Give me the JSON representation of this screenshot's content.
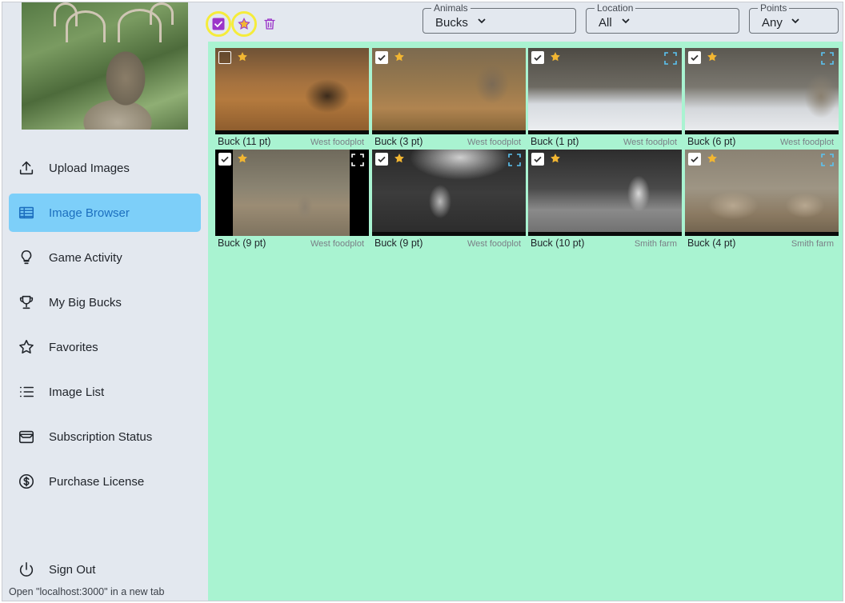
{
  "sidebar": {
    "items": [
      {
        "label": "Upload Images",
        "icon": "upload-icon"
      },
      {
        "label": "Image Browser",
        "icon": "table-icon",
        "active": true
      },
      {
        "label": "Game Activity",
        "icon": "lightbulb-icon"
      },
      {
        "label": "My Big Bucks",
        "icon": "trophy-icon"
      },
      {
        "label": "Favorites",
        "icon": "star-icon"
      },
      {
        "label": "Image List",
        "icon": "list-icon"
      },
      {
        "label": "Subscription Status",
        "icon": "wallet-icon"
      },
      {
        "label": "Purchase License",
        "icon": "dollar-circle-icon"
      }
    ],
    "sign_out": {
      "label": "Sign Out",
      "icon": "power-icon"
    }
  },
  "status_hint": "Open \"localhost:3000\" in a new tab",
  "toolbar": {
    "select_icon": "checkbox-icon",
    "favorite_icon": "star-icon",
    "delete_icon": "trash-icon",
    "filters": {
      "animals": {
        "label": "Animals",
        "value": "Bucks"
      },
      "location": {
        "label": "Location",
        "value": "All"
      },
      "points": {
        "label": "Points",
        "value": "Any"
      }
    }
  },
  "images": [
    {
      "caption": "Buck (11 pt)",
      "location": "West foodplot",
      "checked": false,
      "favorite": true
    },
    {
      "caption": "Buck (3 pt)",
      "location": "West foodplot",
      "checked": true,
      "favorite": true
    },
    {
      "caption": "Buck (1 pt)",
      "location": "West foodplot",
      "checked": true,
      "favorite": true
    },
    {
      "caption": "Buck (6 pt)",
      "location": "West foodplot",
      "checked": true,
      "favorite": true
    },
    {
      "caption": "Buck (9 pt)",
      "location": "West foodplot",
      "checked": true,
      "favorite": true
    },
    {
      "caption": "Buck (9 pt)",
      "location": "West foodplot",
      "checked": true,
      "favorite": true
    },
    {
      "caption": "Buck (10 pt)",
      "location": "Smith farm",
      "checked": true,
      "favorite": true
    },
    {
      "caption": "Buck (4 pt)",
      "location": "Smith farm",
      "checked": true,
      "favorite": true
    }
  ],
  "colors": {
    "accent_active": "#7dcff9",
    "grid_background": "#a9f3d1",
    "sidebar_background": "#e3e8ef",
    "highlight_ring": "#f5ec3b",
    "purple_icon": "#9b35c9",
    "star_gold": "#f2b632"
  }
}
